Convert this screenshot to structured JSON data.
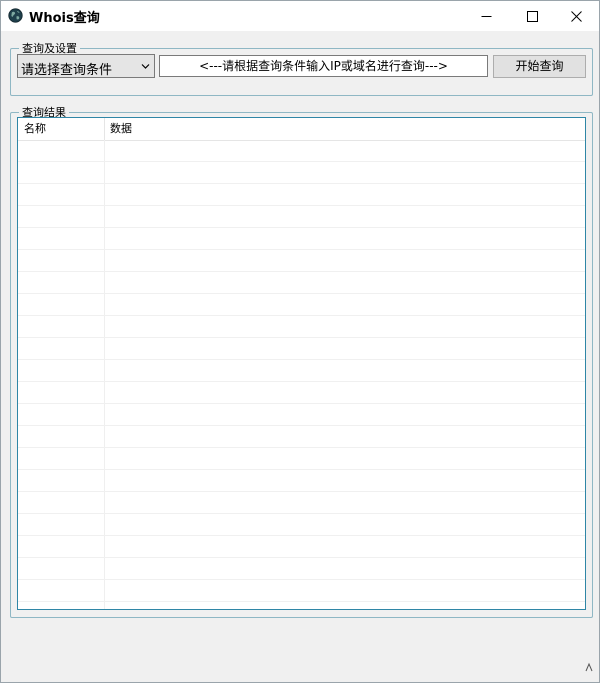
{
  "window": {
    "title": "Whois查询"
  },
  "settings_group": {
    "legend": "查询及设置",
    "condition_select": {
      "selected": "请选择查询条件"
    },
    "query_input": {
      "value": "<---请根据查询条件输入IP或域名进行查询--->"
    },
    "start_button": {
      "label": "开始查询"
    }
  },
  "results_group": {
    "legend": "查询结果",
    "columns": [
      "名称",
      "数据"
    ],
    "rows": []
  },
  "icons": {
    "app": "globe-icon",
    "minimize": "minimize-icon",
    "maximize": "maximize-icon",
    "close": "close-icon",
    "dropdown": "chevron-down-icon",
    "resize": "resize-grip-icon"
  }
}
